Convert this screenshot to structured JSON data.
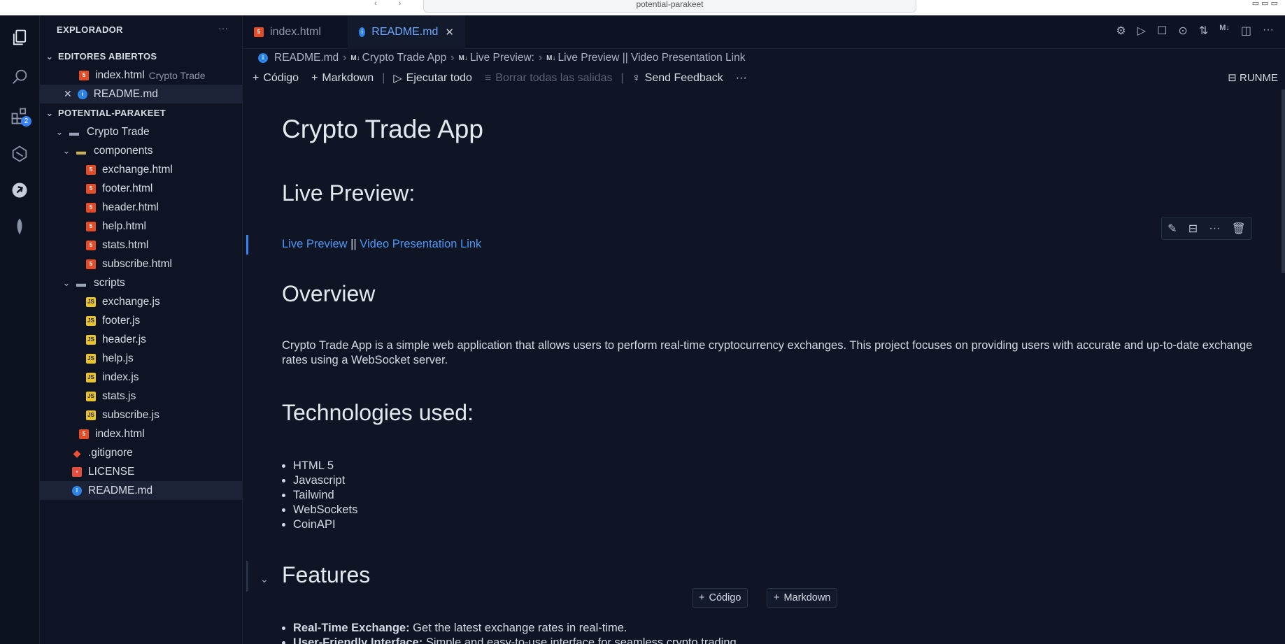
{
  "window": {
    "command_center": "potential-parakeet"
  },
  "sidebar": {
    "title": "EXPLORADOR",
    "more": "···",
    "open_editors": {
      "label": "EDITORES ABIERTOS",
      "items": [
        {
          "name": "index.html",
          "desc": "Crypto Trade",
          "icon": "html-file-icon"
        },
        {
          "name": "README.md",
          "icon": "info-file-icon",
          "close": "✕"
        }
      ]
    },
    "project": {
      "label": "POTENTIAL-PARAKEET",
      "folder": "Crypto Trade",
      "components_folder": "components",
      "components": [
        "exchange.html",
        "footer.html",
        "header.html",
        "help.html",
        "stats.html",
        "subscribe.html"
      ],
      "scripts_folder": "scripts",
      "scripts": [
        "exchange.js",
        "footer.js",
        "header.js",
        "help.js",
        "index.js",
        "stats.js",
        "subscribe.js"
      ],
      "index_file": "index.html",
      "root_files": [
        ".gitignore",
        "LICENSE",
        "README.md"
      ]
    },
    "activity_badge": "2"
  },
  "tabs": [
    {
      "label": "index.html",
      "active": false
    },
    {
      "label": "README.md",
      "active": true,
      "close": "✕"
    }
  ],
  "breadcrumb": {
    "file": "README.md",
    "parts": [
      "Crypto Trade App",
      "Live Preview:",
      "Live Preview || Video Presentation Link"
    ],
    "md_badge": "M↓"
  },
  "toolbar": {
    "code": "Código",
    "markdown": "Markdown",
    "run_all": "Ejecutar todo",
    "clear_outputs": "Borrar todas las salidas",
    "feedback": "Send Feedback",
    "more": "···",
    "runme": "RUNME"
  },
  "doc": {
    "title": "Crypto Trade App",
    "live_preview_heading": "Live Preview:",
    "live_preview_link": "Live Preview",
    "link_sep": " || ",
    "video_link": "Video Presentation Link",
    "overview_heading": "Overview",
    "overview_text": "Crypto Trade App is a simple web application that allows users to perform real-time cryptocurrency exchanges. This project focuses on providing users with accurate and up-to-date exchange rates using a WebSocket server.",
    "tech_heading": "Technologies used:",
    "tech_list": [
      "HTML 5",
      "Javascript",
      "Tailwind",
      "WebSockets",
      "CoinAPI"
    ],
    "features_heading": "Features",
    "features": [
      {
        "bold": "Real-Time Exchange:",
        "text": " Get the latest exchange rates in real-time."
      },
      {
        "bold": "User-Friendly Interface:",
        "text": " Simple and easy-to-use interface for seamless crypto trading."
      }
    ],
    "add_code": "Código",
    "add_markdown": "Markdown"
  }
}
